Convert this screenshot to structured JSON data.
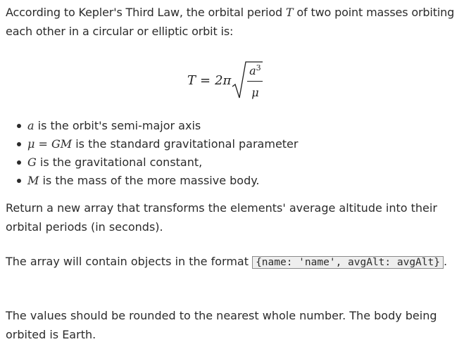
{
  "intro": {
    "text_before": "According to Kepler's Third Law, the orbital period ",
    "var_T": "T",
    "text_after": " of two point masses orbiting each other in a circular or elliptic orbit is:"
  },
  "formula": {
    "lhs": "T",
    "equals": "=",
    "coef": "2π",
    "numerator_base": "a",
    "numerator_exp": "3",
    "denominator": "μ"
  },
  "list": [
    {
      "var": "a",
      "text": " is the orbit's semi-major axis"
    },
    {
      "var": "μ = GM",
      "text": " is the standard gravitational parameter"
    },
    {
      "var": "G",
      "text": " is the gravitational constant,"
    },
    {
      "var": "M",
      "text": " is the mass of the more massive body."
    }
  ],
  "para2": "Return a new array that transforms the elements' average altitude into their orbital periods (in seconds).",
  "para3": {
    "before": "The array will contain objects in the format ",
    "code": "{name: 'name', avgAlt: avgAlt}",
    "after": "."
  },
  "para4": "The values should be rounded to the nearest whole number. The body being orbited is Earth."
}
